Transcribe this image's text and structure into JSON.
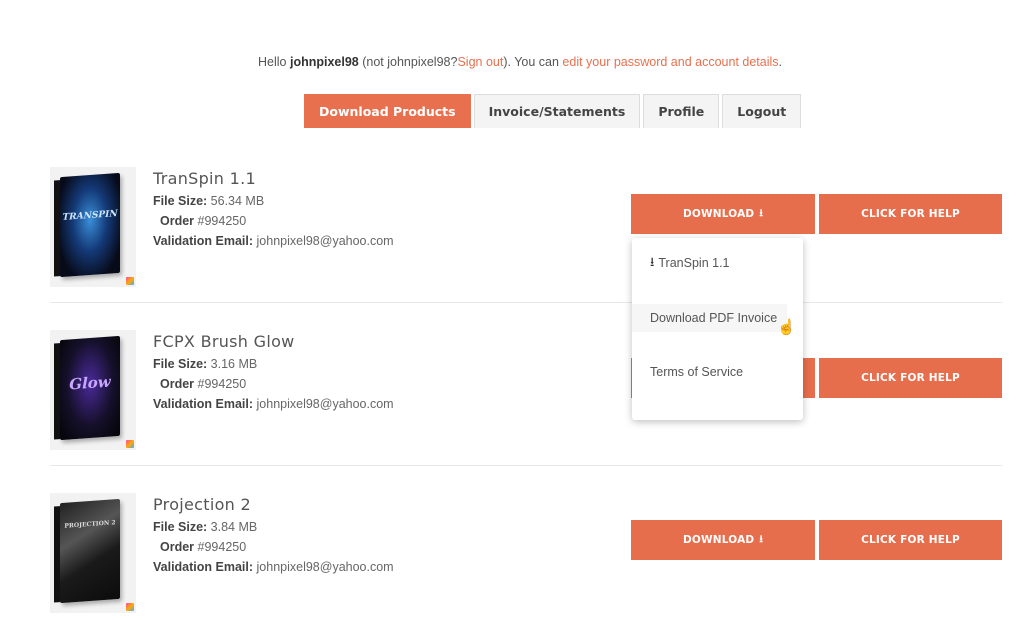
{
  "greeting": {
    "hello": "Hello",
    "username": "johnpixel98",
    "not_prefix": "(not johnpixel98?",
    "sign_out": "Sign out",
    "not_suffix": "). You can",
    "edit_link": "edit your password and account details",
    "end": "."
  },
  "tabs": [
    {
      "label": "Download Products",
      "active": true
    },
    {
      "label": "Invoice/Statements",
      "active": false
    },
    {
      "label": "Profile",
      "active": false
    },
    {
      "label": "Logout",
      "active": false
    }
  ],
  "labels": {
    "file_size": "File Size:",
    "order": "Order",
    "validation_email": "Validation Email:",
    "download_button": "DOWNLOAD",
    "help_button": "CLICK FOR HELP",
    "download_icon": "⭳"
  },
  "products": [
    {
      "name": "TranSpin 1.1",
      "file_size": "56.34 MB",
      "order": "#994250",
      "email": "johnpixel98@yahoo.com",
      "box_text": "TRANSPIN"
    },
    {
      "name": "FCPX Brush Glow",
      "file_size": "3.16 MB",
      "order": "#994250",
      "email": "johnpixel98@yahoo.com",
      "box_text": "Glow"
    },
    {
      "name": "Projection 2",
      "file_size": "3.84 MB",
      "order": "#994250",
      "email": "johnpixel98@yahoo.com",
      "box_text": "PROJECTION 2"
    }
  ],
  "dropdown": {
    "items": [
      {
        "label": "TranSpin 1.1",
        "icon": "download-icon"
      },
      {
        "label": "Download PDF Invoice"
      },
      {
        "label": "Terms of Service"
      }
    ]
  },
  "colors": {
    "accent": "#e66e4c"
  }
}
